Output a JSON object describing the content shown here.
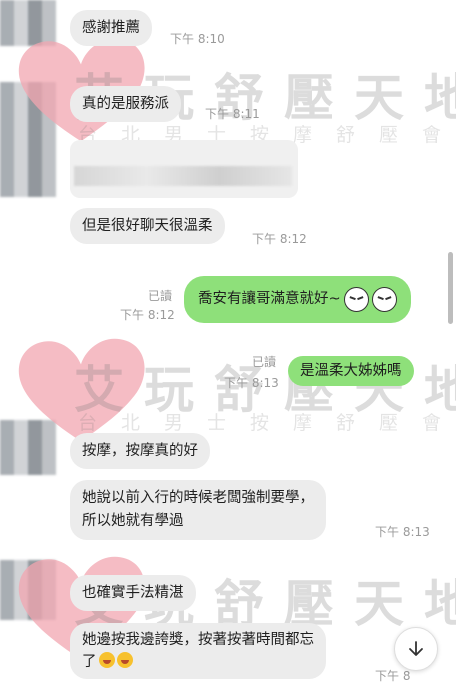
{
  "watermark": {
    "title": "艾玩舒壓天地",
    "subtitle": "台北男士按摩舒壓會館"
  },
  "messages": [
    {
      "id": "m1",
      "text": "感謝推薦",
      "time": "下午 8:10"
    },
    {
      "id": "m2",
      "text": "真的是服務派",
      "time": "下午 8:11"
    },
    {
      "id": "m3",
      "text": "但是很好聊天很溫柔",
      "time": "下午 8:12"
    },
    {
      "id": "m4",
      "text": "喬安有讓哥滿意就好~",
      "time": "下午 8:12",
      "read": "已讀"
    },
    {
      "id": "m5",
      "text": "是溫柔大姊姊嗎",
      "time": "下午 8:13",
      "read": "已讀"
    },
    {
      "id": "m6",
      "text": "按摩，按摩真的好"
    },
    {
      "id": "m7",
      "line1": "她說以前入行的時候老闆強制要學，",
      "line2": "所以她就有學過",
      "time": "下午 8:13"
    },
    {
      "id": "m8",
      "text": "也確實手法精湛"
    },
    {
      "id": "m9",
      "line1": "她邊按我邊誇獎，按著按著時間都忘",
      "line2": "了",
      "time": "下午 8"
    }
  ],
  "icons": {
    "emoji": "squinting-laugh-face-icon",
    "laugh": "laughing-tears-icon",
    "scroll": "arrow-down-icon"
  },
  "colors": {
    "incoming_bubble": "#ececec",
    "outgoing_bubble": "#8ee07a",
    "watermark_heart": "#f2a6b0"
  }
}
